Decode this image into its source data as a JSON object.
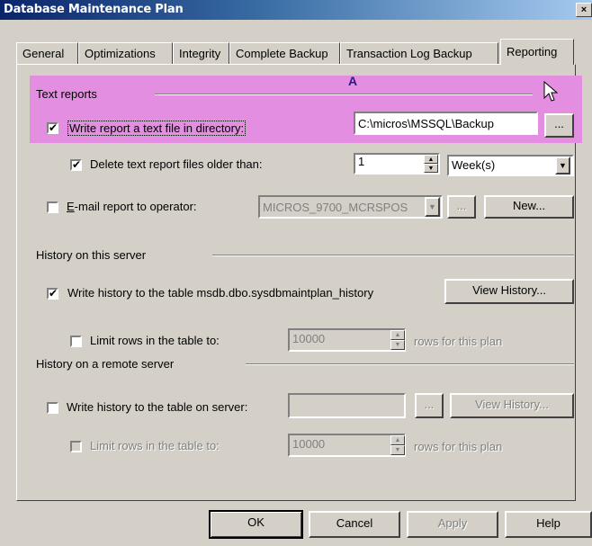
{
  "window": {
    "title": "Database Maintenance Plan",
    "close": "×"
  },
  "tabs": [
    "General",
    "Optimizations",
    "Integrity",
    "Complete Backup",
    "Transaction Log Backup",
    "Reporting"
  ],
  "annotation": "A",
  "text_reports": {
    "group_label": "Text reports",
    "write_report_label": "Write report a text file in directory:",
    "directory_value": "C:\\micros\\MSSQL\\Backup",
    "browse_label": "...",
    "delete_label": "Delete text report files older than:",
    "delete_count": "1",
    "delete_unit": "Week(s)",
    "email_label": "E-mail report to operator:",
    "operator_value": "MICROS_9700_MCRSPOS",
    "operator_browse": "...",
    "new_button": "New..."
  },
  "history_local": {
    "group_label": "History on this server",
    "write_history_label": "Write history to the table msdb.dbo.sysdbmaintplan_history",
    "view_history_button": "View History...",
    "limit_rows_label": "Limit rows in the table to:",
    "limit_rows_value": "10000",
    "rows_suffix": "rows for this plan"
  },
  "history_remote": {
    "group_label": "History on a remote server",
    "write_history_label": "Write history to the table on server:",
    "server_value": "",
    "browse_label": "...",
    "view_history_button": "View History...",
    "limit_rows_label": "Limit rows in the table to:",
    "limit_rows_value": "10000",
    "rows_suffix": "rows for this plan"
  },
  "buttons": {
    "ok": "OK",
    "cancel": "Cancel",
    "apply": "Apply",
    "help": "Help"
  }
}
